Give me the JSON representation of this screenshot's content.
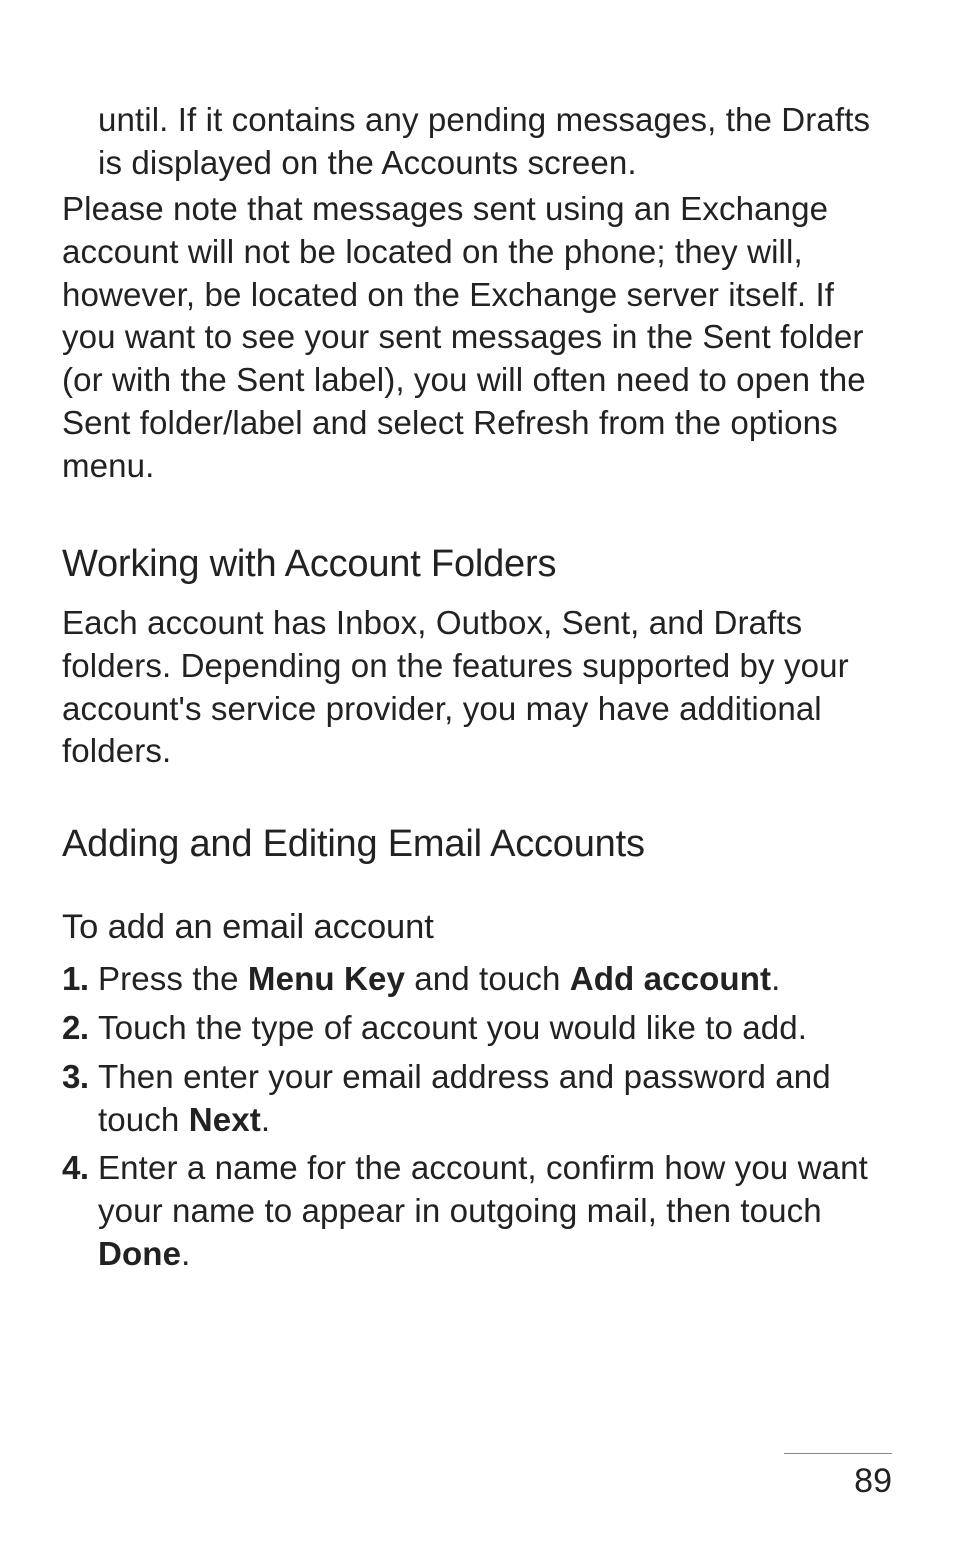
{
  "intro": {
    "carryover": "until. If it contains any pending messages, the Drafts is displayed on the Accounts screen.",
    "note": "Please note that messages sent using an Exchange account will not be located on the phone; they will, however, be located on the Exchange server itself. If you want to see your sent messages in the Sent folder (or with the Sent label), you will often need to open the Sent folder/label and select Refresh from the options menu."
  },
  "section1": {
    "heading": "Working with Account Folders",
    "body": "Each account has Inbox, Outbox, Sent, and Drafts folders. Depending on the features supported by your account's service provider, you may have additional folders."
  },
  "section2": {
    "heading": "Adding and Editing Email Accounts",
    "subhead": "To add an email account",
    "steps": {
      "s1": {
        "pre": " Press the ",
        "b1": "Menu Key",
        "mid": " and touch ",
        "b2": "Add account",
        "post": "."
      },
      "s2": {
        "text": "Touch the type of account you would like to add."
      },
      "s3": {
        "pre": "Then enter your email address and password and touch ",
        "b1": "Next",
        "post": "."
      },
      "s4": {
        "pre": "Enter a name for the account, confirm how you want your name to appear in outgoing mail, then touch ",
        "b1": "Done",
        "post": "."
      }
    }
  },
  "page_number": "89"
}
